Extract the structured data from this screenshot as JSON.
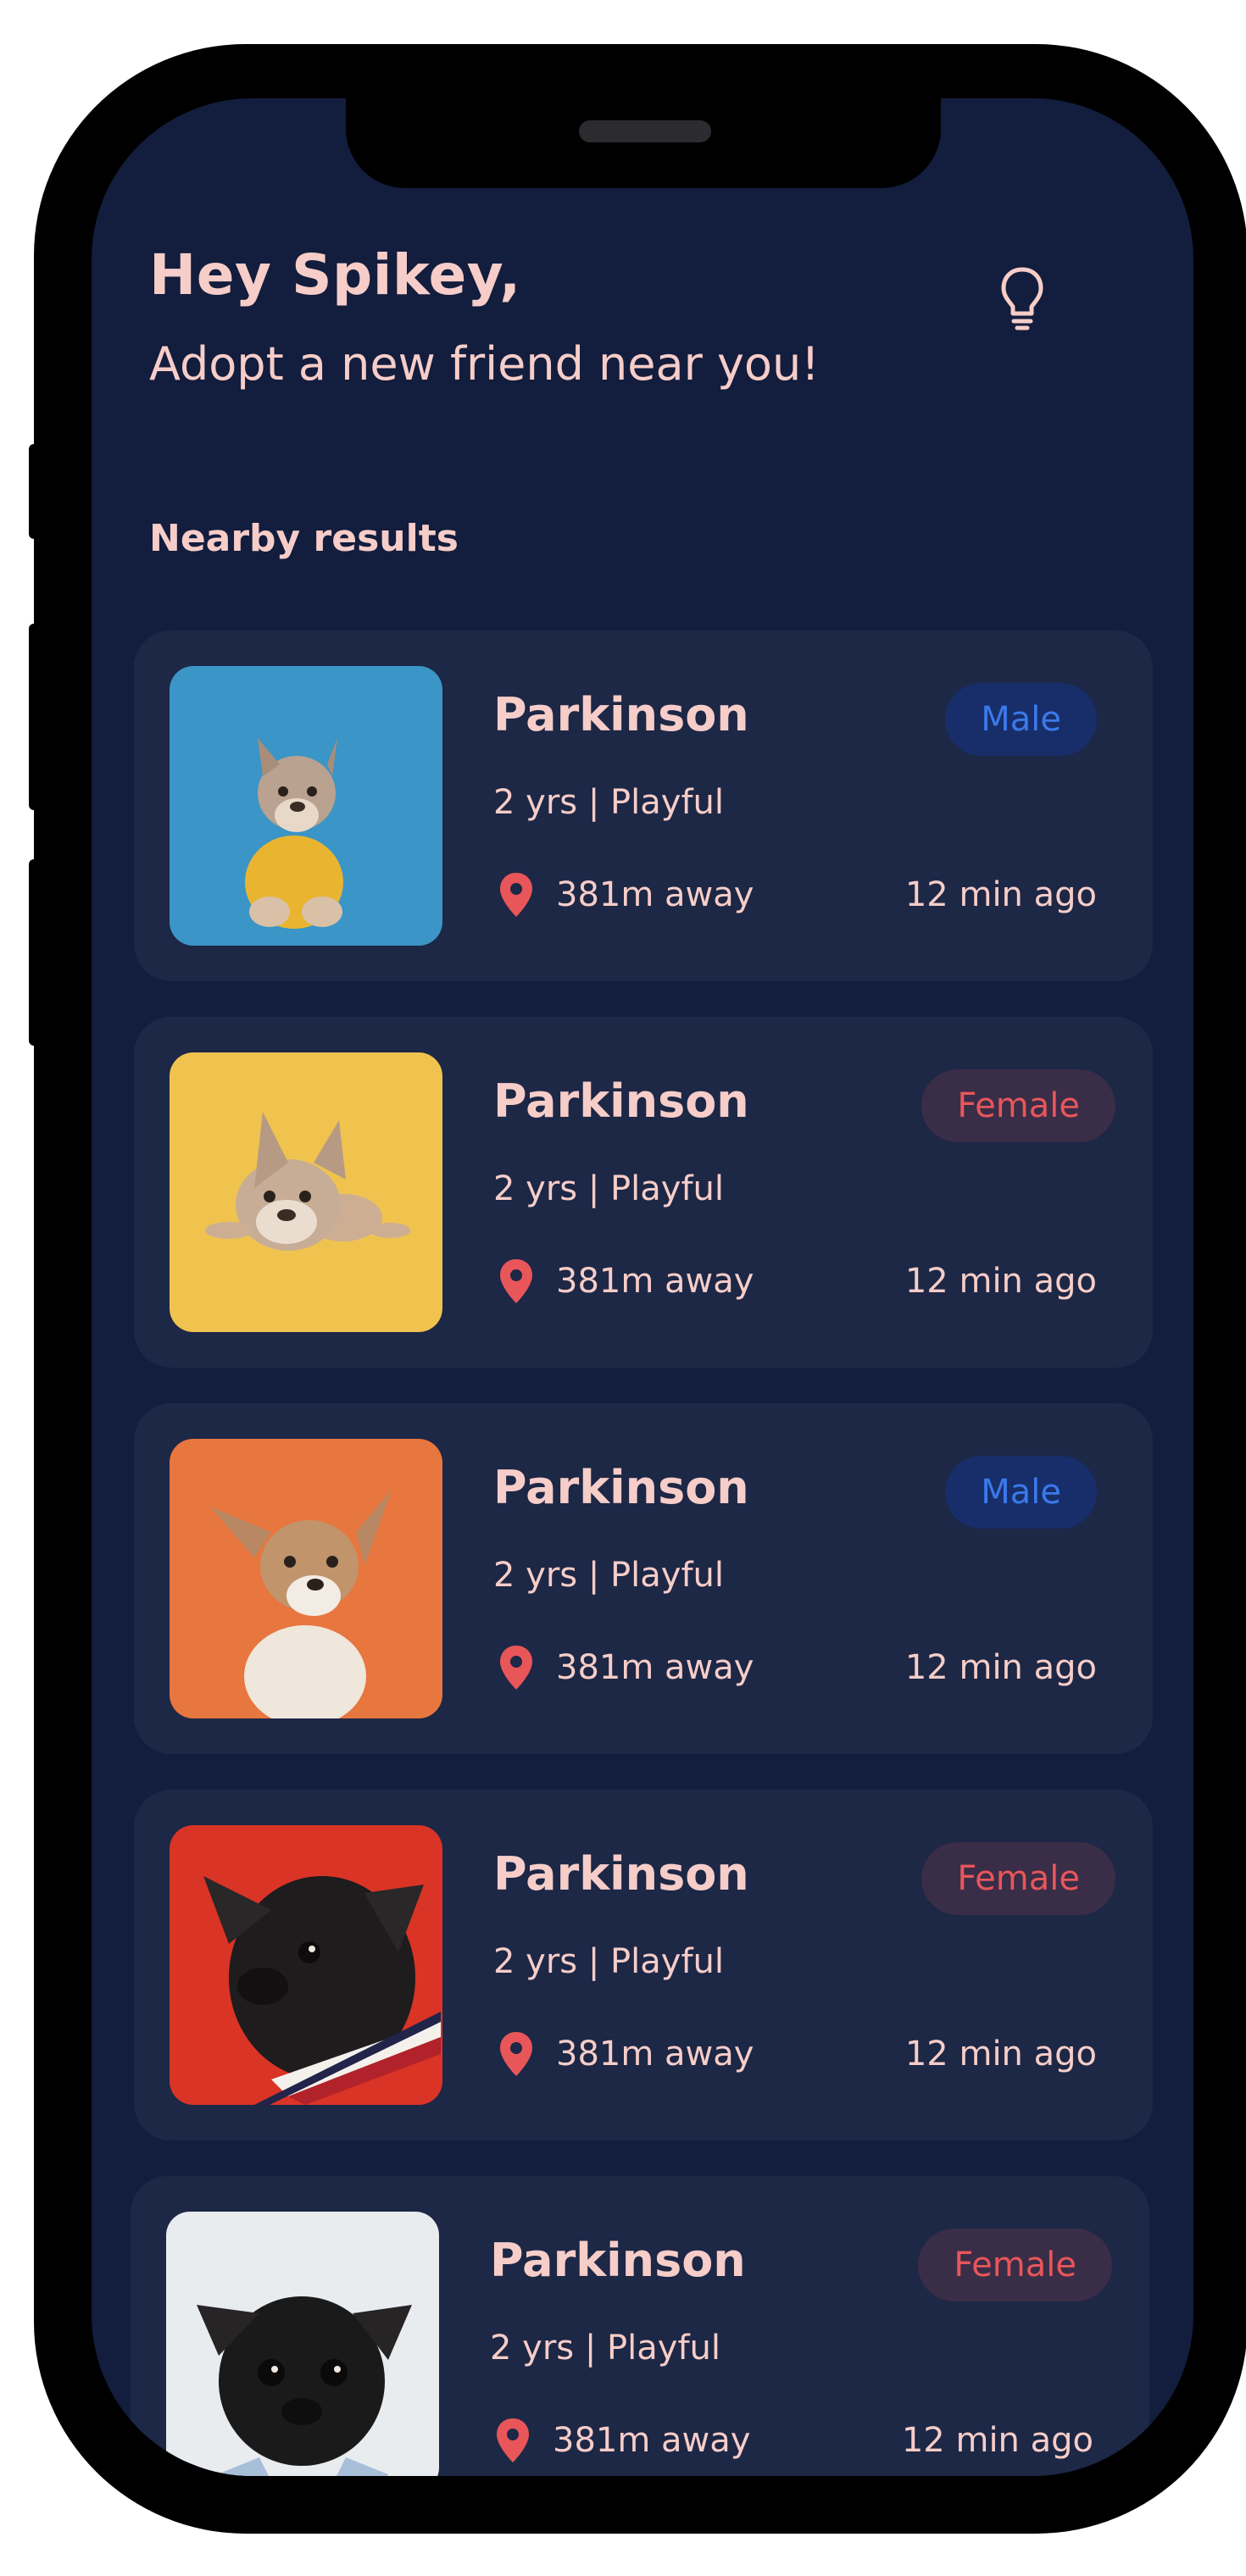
{
  "header": {
    "greeting": "Hey Spikey,",
    "subtitle": "Adopt a new friend near you!",
    "icon": "lightbulb-icon"
  },
  "section": {
    "title": "Nearby results"
  },
  "colors": {
    "background": "#131d3d",
    "card": "#1d2746",
    "text": "#f6cdc8",
    "male_badge_bg": "#182e6a",
    "male_badge_text": "#3b79ea",
    "female_badge_bg": "#3a2d47",
    "female_badge_text": "#e8565a",
    "pin": "#e8565a"
  },
  "pets": [
    {
      "name": "Parkinson",
      "gender": "Male",
      "details": "2 yrs | Playful",
      "distance": "381m away",
      "posted": "12 min ago",
      "photo_bg": "#3b95c6"
    },
    {
      "name": "Parkinson",
      "gender": "Female",
      "details": "2 yrs | Playful",
      "distance": "381m away",
      "posted": "12 min ago",
      "photo_bg": "#f0c34f"
    },
    {
      "name": "Parkinson",
      "gender": "Male",
      "details": "2 yrs | Playful",
      "distance": "381m away",
      "posted": "12 min ago",
      "photo_bg": "#e8763f"
    },
    {
      "name": "Parkinson",
      "gender": "Female",
      "details": "2 yrs | Playful",
      "distance": "381m away",
      "posted": "12 min ago",
      "photo_bg": "#d93426"
    },
    {
      "name": "Parkinson",
      "gender": "Female",
      "details": "2 yrs | Playful",
      "distance": "381m away",
      "posted": "12 min ago",
      "photo_bg": "#e9ecef"
    }
  ]
}
